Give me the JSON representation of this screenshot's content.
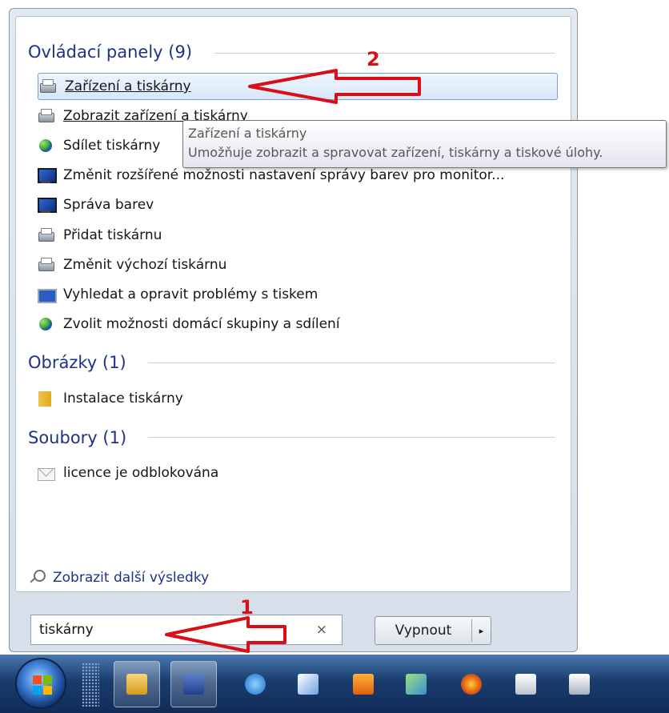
{
  "groups": {
    "control_panel": {
      "header": "Ovládací panely (9)",
      "items": [
        {
          "label": "Zařízení a tiskárny",
          "icon": "printer-icon"
        },
        {
          "label": "Zobrazit zařízení a tiskárny",
          "icon": "printer-icon"
        },
        {
          "label": "Sdílet tiskárny",
          "icon": "homegroup-share-icon"
        },
        {
          "label": "Změnit rozšířené možnosti nastavení správy barev pro monitor...",
          "icon": "monitor-color-icon"
        },
        {
          "label": "Správa barev",
          "icon": "monitor-color-icon"
        },
        {
          "label": "Přidat tiskárnu",
          "icon": "printer-icon"
        },
        {
          "label": "Změnit výchozí tiskárnu",
          "icon": "printer-icon"
        },
        {
          "label": "Vyhledat a opravit problémy s tiskem",
          "icon": "troubleshoot-icon"
        },
        {
          "label": "Zvolit možnosti domácí skupiny a sdílení",
          "icon": "homegroup-share-icon"
        }
      ]
    },
    "pictures": {
      "header": "Obrázky (1)",
      "items": [
        {
          "label": "Instalace tiskárny",
          "icon": "folder-icon"
        }
      ]
    },
    "files": {
      "header": "Soubory (1)",
      "items": [
        {
          "label": "licence je odblokována",
          "icon": "envelope-icon"
        }
      ]
    }
  },
  "tooltip": {
    "title": "Zařízení a tiskárny",
    "description": "Umožňuje zobrazit a spravovat zařízení, tiskárny a tiskové úlohy."
  },
  "more_results": {
    "label": "Zobrazit další výsledky",
    "icon": "search-icon"
  },
  "search": {
    "value": "tiskárny",
    "clear_icon": "×"
  },
  "shutdown": {
    "label": "Vypnout",
    "arrow": "▸"
  },
  "annotations": {
    "one": "1",
    "two": "2",
    "color": "#d80f16"
  },
  "taskbar": {
    "items": [
      "start-orb",
      "grip",
      "explorer-icon",
      "save-icon",
      "internet-explorer-icon",
      "paint-icon",
      "media-icon",
      "network-icon",
      "firefox-icon",
      "calendar-icon",
      "app-icon"
    ]
  },
  "colors": {
    "header_text": "#1e3287",
    "selected_bg": "#d6e7fb",
    "selected_border": "#7da2ce"
  }
}
